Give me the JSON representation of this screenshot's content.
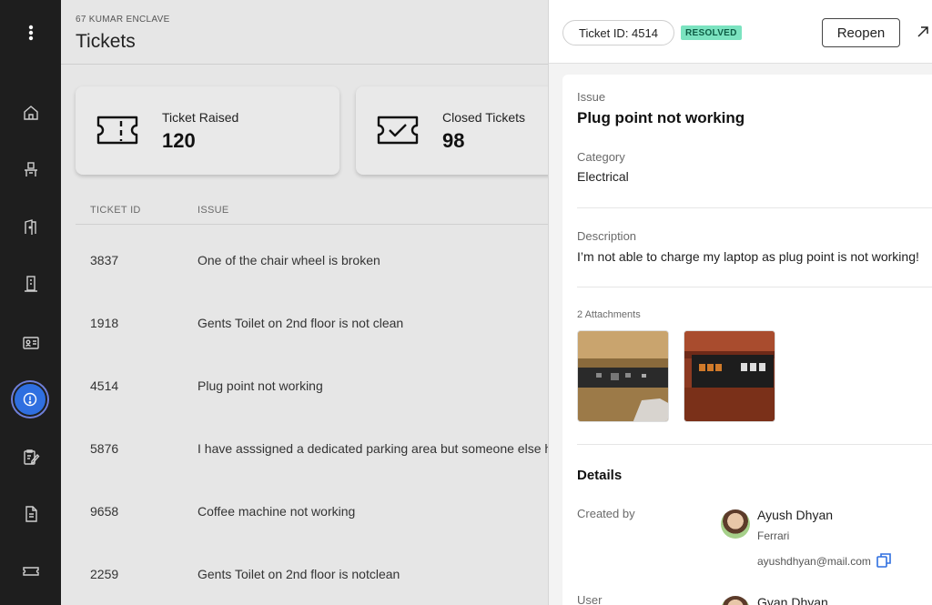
{
  "sidebar": {
    "icons": [
      "more-vertical-icon",
      "home-icon",
      "desk-icon",
      "door-icon",
      "building-icon",
      "id-card-icon",
      "alert-circle-icon",
      "clipboard-edit-icon",
      "document-icon",
      "ticket-icon"
    ],
    "active": "alert-circle-icon"
  },
  "header": {
    "breadcrumb": "67 KUMAR ENCLAVE",
    "title": "Tickets"
  },
  "stats": [
    {
      "label": "Ticket Raised",
      "value": "120"
    },
    {
      "label": "Closed Tickets",
      "value": "98"
    }
  ],
  "table": {
    "columns": [
      "TICKET ID",
      "ISSUE"
    ],
    "rows": [
      {
        "id": "3837",
        "issue": "One of the chair wheel is broken"
      },
      {
        "id": "1918",
        "issue": "Gents Toilet on 2nd floor is not clean"
      },
      {
        "id": "4514",
        "issue": "Plug point not working"
      },
      {
        "id": "5876",
        "issue": "I have asssigned a dedicated parking area but someone else h"
      },
      {
        "id": "9658",
        "issue": "Coffee machine not working"
      },
      {
        "id": "2259",
        "issue": "Gents Toilet on 2nd floor is notclean"
      }
    ]
  },
  "panel": {
    "ticket_id": "Ticket ID: 4514",
    "status": "RESOLVED",
    "reopen": "Reopen",
    "issue_label": "Issue",
    "issue": "Plug point not working",
    "category_label": "Category",
    "category": "Electrical",
    "description_label": "Description",
    "description": "I’m not able to charge my laptop as plug point is not working!",
    "attachments_label": "2 Attachments",
    "details_heading": "Details",
    "created_by_label": "Created by",
    "created_by": {
      "name": "Ayush Dhyan",
      "company": "Ferrari",
      "email": "ayushdhyan@mail.com"
    },
    "user_label": "User",
    "user": {
      "name": "Gyan Dhyan"
    }
  },
  "colors": {
    "sidebar_bg": "#1e1e1e",
    "active_blue": "#2f6fe0",
    "resolved_green": "#7be3c0"
  }
}
